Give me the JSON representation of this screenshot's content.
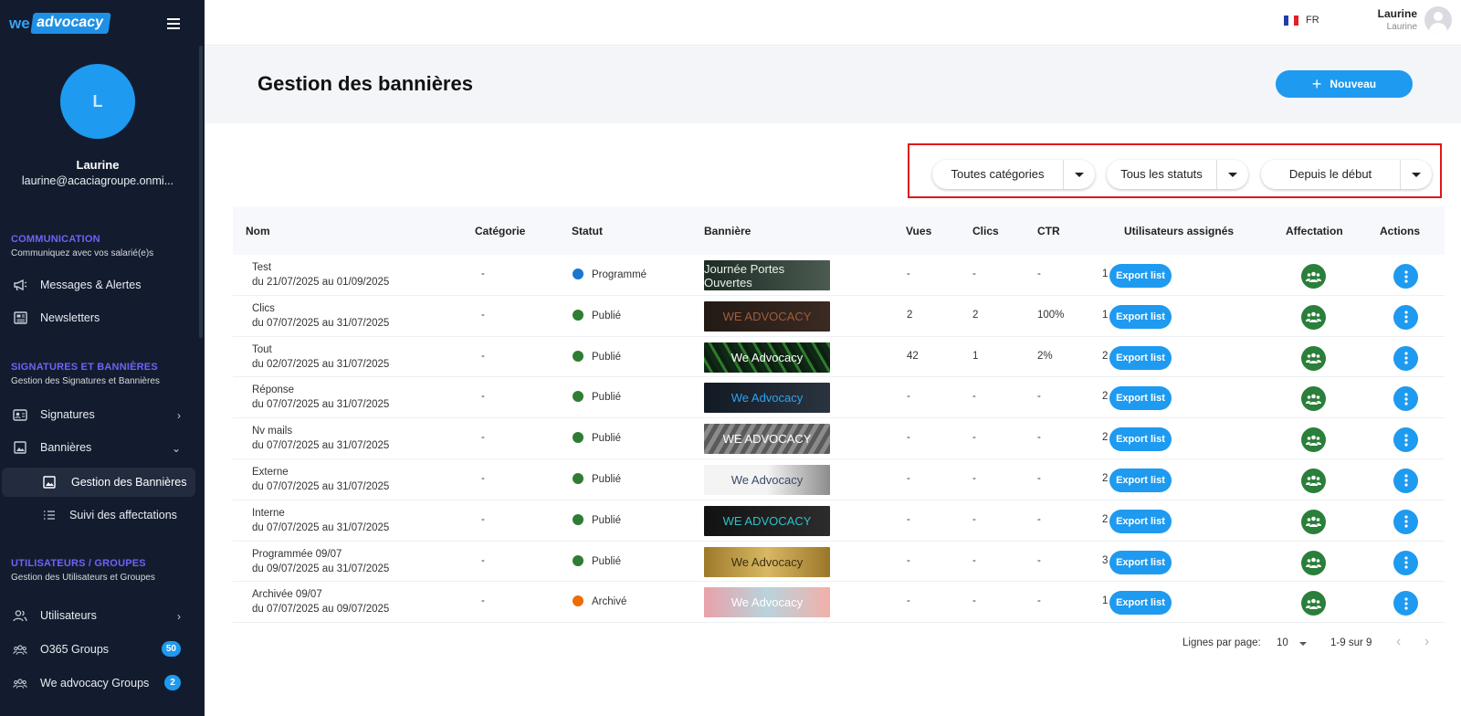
{
  "brand": {
    "we": "we",
    "advocacy": "advocacy"
  },
  "profile": {
    "initial": "L",
    "name": "Laurine",
    "email": "laurine@acaciagroupe.onmi..."
  },
  "sections": [
    {
      "title": "COMMUNICATION",
      "subtitle": "Communiquez avec vos salarié(e)s"
    },
    {
      "title": "SIGNATURES ET BANNIÈRES",
      "subtitle": "Gestion des Signatures et Bannières"
    },
    {
      "title": "UTILISATEURS / GROUPES",
      "subtitle": "Gestion des Utilisateurs et Groupes"
    }
  ],
  "nav": {
    "messages": "Messages & Alertes",
    "newsletters": "Newsletters",
    "signatures": "Signatures",
    "bannieres": "Bannières",
    "gestion": "Gestion des Bannières",
    "suivi": "Suivi des affectations",
    "utilisateurs": "Utilisateurs",
    "o365": "O365 Groups",
    "o365_count": "50",
    "wegroups": "We advocacy Groups",
    "wegroups_count": "2"
  },
  "header": {
    "lang": "FR",
    "user_name": "Laurine",
    "user_sub": "Laurine"
  },
  "page": {
    "title": "Gestion des bannières",
    "new_button": "Nouveau"
  },
  "filters": {
    "category": "Toutes catégories",
    "status": "Tous les statuts",
    "period": "Depuis le début"
  },
  "table": {
    "columns": [
      "Nom",
      "Catégorie",
      "Statut",
      "Bannière",
      "Vues",
      "Clics",
      "CTR",
      "Utilisateurs assignés",
      "Affectation",
      "Actions"
    ],
    "export_label": "Export list",
    "rows": [
      {
        "name": "Test",
        "dates": "du 21/07/2025 au 01/09/2025",
        "category": "-",
        "status": "Programmé",
        "status_color": "#1976d2",
        "banner": "Journée Portes Ouvertes",
        "views": "-",
        "clicks": "-",
        "ctr": "-",
        "assigned": "1"
      },
      {
        "name": "Clics",
        "dates": "du 07/07/2025 au 31/07/2025",
        "category": "-",
        "status": "Publié",
        "status_color": "#2e7d32",
        "banner": "WE ADVOCACY",
        "views": "2",
        "clicks": "2",
        "ctr": "100%",
        "assigned": "1"
      },
      {
        "name": "Tout",
        "dates": "du 02/07/2025 au 31/07/2025",
        "category": "-",
        "status": "Publié",
        "status_color": "#2e7d32",
        "banner": "We Advocacy",
        "views": "42",
        "clicks": "1",
        "ctr": "2%",
        "assigned": "2"
      },
      {
        "name": "Réponse",
        "dates": "du 07/07/2025 au 31/07/2025",
        "category": "-",
        "status": "Publié",
        "status_color": "#2e7d32",
        "banner": "We Advocacy",
        "views": "-",
        "clicks": "-",
        "ctr": "-",
        "assigned": "2"
      },
      {
        "name": "Nv mails",
        "dates": "du 07/07/2025 au 31/07/2025",
        "category": "-",
        "status": "Publié",
        "status_color": "#2e7d32",
        "banner": "WE ADVOCACY",
        "views": "-",
        "clicks": "-",
        "ctr": "-",
        "assigned": "2"
      },
      {
        "name": "Externe",
        "dates": "du 07/07/2025 au 31/07/2025",
        "category": "-",
        "status": "Publié",
        "status_color": "#2e7d32",
        "banner": "We Advocacy",
        "views": "-",
        "clicks": "-",
        "ctr": "-",
        "assigned": "2"
      },
      {
        "name": "Interne",
        "dates": "du 07/07/2025 au 31/07/2025",
        "category": "-",
        "status": "Publié",
        "status_color": "#2e7d32",
        "banner": "WE ADVOCACY",
        "views": "-",
        "clicks": "-",
        "ctr": "-",
        "assigned": "2"
      },
      {
        "name": "Programmée 09/07",
        "dates": "du 09/07/2025 au 31/07/2025",
        "category": "-",
        "status": "Publié",
        "status_color": "#2e7d32",
        "banner": "We Advocacy",
        "views": "-",
        "clicks": "-",
        "ctr": "-",
        "assigned": "3"
      },
      {
        "name": "Archivée 09/07",
        "dates": "du 07/07/2025 au 09/07/2025",
        "category": "-",
        "status": "Archivé",
        "status_color": "#ef6c00",
        "banner": "We Advocacy",
        "views": "-",
        "clicks": "-",
        "ctr": "-",
        "assigned": "1"
      }
    ]
  },
  "pagination": {
    "rows_label": "Lignes par page:",
    "rows_value": "10",
    "range": "1-9 sur 9"
  },
  "colors": {
    "sidebar": "#131c2e",
    "accent": "#1e9af0",
    "section": "#6d63f5",
    "affectation": "#2a7f3a",
    "highlight": "#e0171b"
  }
}
